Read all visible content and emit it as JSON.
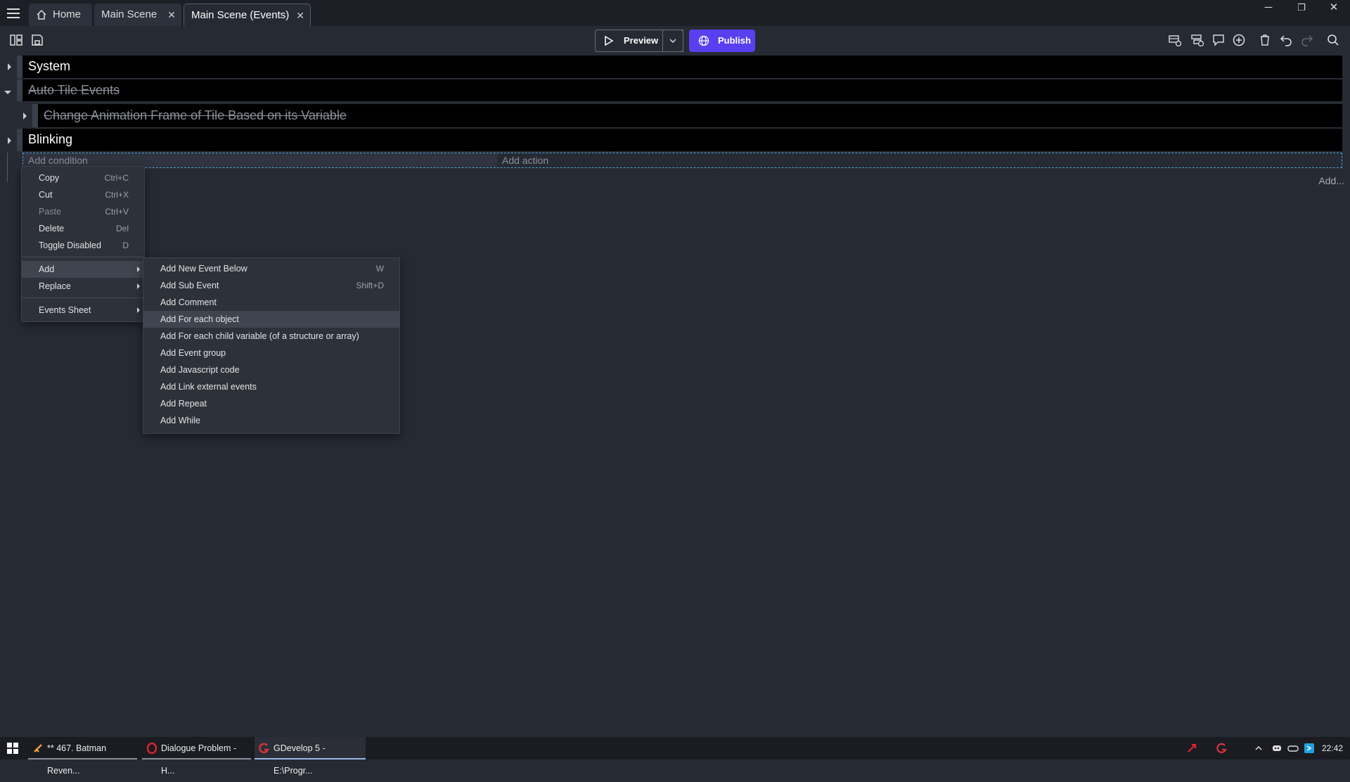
{
  "tabs": [
    {
      "label": "Home",
      "icon": "home-icon"
    },
    {
      "label": "Main Scene",
      "close": "✕"
    },
    {
      "label": "Main Scene (Events)",
      "close": "✕"
    }
  ],
  "toolbar": {
    "preview_label": "Preview",
    "publish_label": "Publish",
    "accent_color": "#5a3ff0"
  },
  "events": [
    {
      "label": "System",
      "disabled": false
    },
    {
      "label": "Auto Tile Events",
      "disabled": true
    },
    {
      "label": "Change Animation Frame of Tile Based on its Variable",
      "disabled": true
    },
    {
      "label": "Blinking",
      "disabled": false
    }
  ],
  "event_row": {
    "add_condition": "Add condition",
    "add_action": "Add action",
    "add_more": "Add..."
  },
  "context_menu": {
    "items": [
      {
        "label": "Copy",
        "shortcut": "Ctrl+C"
      },
      {
        "label": "Cut",
        "shortcut": "Ctrl+X"
      },
      {
        "label": "Paste",
        "shortcut": "Ctrl+V",
        "disabled": true
      },
      {
        "label": "Delete",
        "shortcut": "Del"
      },
      {
        "label": "Toggle Disabled",
        "shortcut": "D"
      },
      {
        "label": "Add",
        "submenu": true,
        "highlighted": true
      },
      {
        "label": "Replace",
        "submenu": true
      },
      {
        "label": "Events Sheet",
        "submenu": true
      }
    ]
  },
  "add_submenu": {
    "items": [
      {
        "label": "Add New Event Below",
        "shortcut": "W"
      },
      {
        "label": "Add Sub Event",
        "shortcut": "Shift+D"
      },
      {
        "label": "Add Comment",
        "shortcut": ""
      },
      {
        "label": "Add For each object",
        "shortcut": "",
        "highlighted": true
      },
      {
        "label": "Add For each child variable (of a structure or array)",
        "shortcut": ""
      },
      {
        "label": "Add Event group",
        "shortcut": ""
      },
      {
        "label": "Add Javascript code",
        "shortcut": ""
      },
      {
        "label": "Add Link external events",
        "shortcut": ""
      },
      {
        "label": "Add Repeat",
        "shortcut": ""
      },
      {
        "label": "Add While",
        "shortcut": ""
      }
    ]
  },
  "taskbar": {
    "tasks": [
      {
        "label": "** 467. Batman Reven..."
      },
      {
        "label": "Dialogue Problem - H..."
      },
      {
        "label": "GDevelop 5 - E:\\Progr..."
      }
    ],
    "clock": "22:42"
  }
}
